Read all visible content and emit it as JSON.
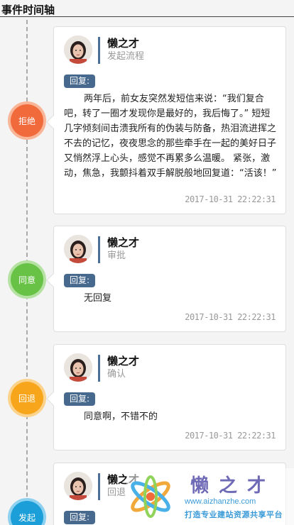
{
  "page": {
    "title": "事件时间轴"
  },
  "timeline": [
    {
      "node_label": "拒绝",
      "node_color": "#f06a3c",
      "user": "懒之才",
      "action": "发起流程",
      "reply_label": "回复:",
      "reply_text": "两年后，前女友突然发短信来说：“我们复合吧，转了一圈才发现你是最好的，我后悔了。” 短短几字倾刻间击溃我所有的伪装与防备，热泪流进挥之不去的记忆，夜夜思念的那些牵手在一起的美好日子又悄然浮上心头，感觉不再累多么温暖。 紧张，激动，焦急，我颤抖着双手解脱般地回复道：“活该！”",
      "time": "2017-10-31 22:22:31"
    },
    {
      "node_label": "同意",
      "node_color": "#67c246",
      "user": "懒之才",
      "action": "审批",
      "reply_label": "回复:",
      "reply_text": "无回复",
      "time": "2017-10-31 22:22:31"
    },
    {
      "node_label": "回退",
      "node_color": "#f7a51b",
      "user": "懒之才",
      "action": "确认",
      "reply_label": "回复:",
      "reply_text": "同意啊，不错不的",
      "time": "2017-10-31 22:22:31"
    },
    {
      "node_label": "发起",
      "node_color": "#1c9fd8",
      "user": "懒之才",
      "action": "回退",
      "reply_label": "回复:"
    }
  ],
  "watermark": {
    "title": "懒之才",
    "url": "www.aizhanzhe.com",
    "slogan": "打造专业建站资源共享平台"
  },
  "icons": {
    "avatar": "user-avatar-icon",
    "logo": "aizhanzhe-logo-icon"
  }
}
